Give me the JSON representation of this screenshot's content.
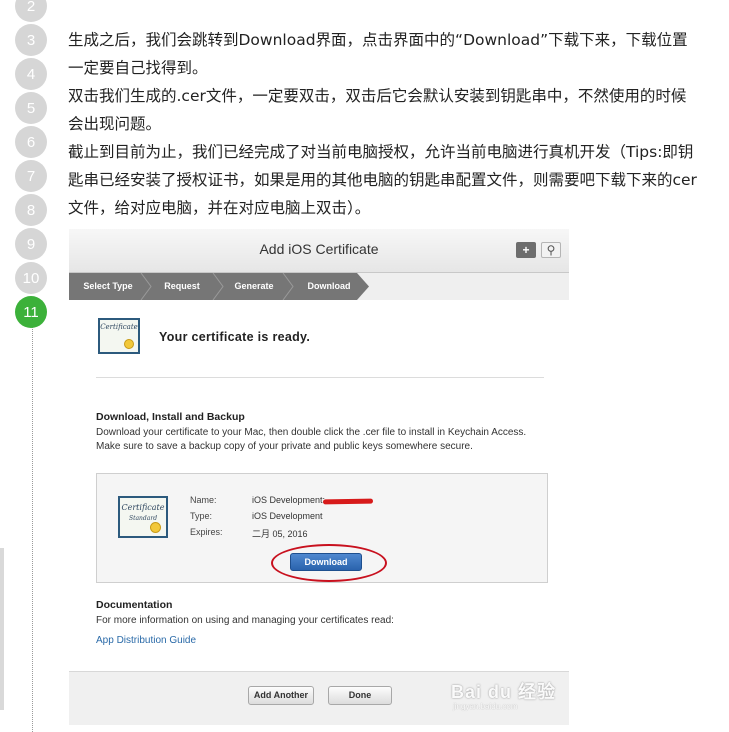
{
  "steps": [
    "2",
    "3",
    "4",
    "5",
    "6",
    "7",
    "8",
    "9",
    "10",
    "11"
  ],
  "article": {
    "p1": "生成之后，我们会跳转到Download界面，点击界面中的“Download”下载下来，下载位置一定要自己找得到。",
    "p2": "双击我们生成的.cer文件，一定要双击，双击后它会默认安装到钥匙串中，不然使用的时候会出现问题。",
    "p3": "截止到目前为止，我们已经完成了对当前电脑授权，允许当前电脑进行真机开发（Tips:即钥匙串已经安装了授权证书，如果是用的其他电脑的钥匙串配置文件，则需要吧下载下来的cer文件，给对应电脑，并在对应电脑上双击）。"
  },
  "screenshot": {
    "title": "Add iOS Certificate",
    "header_icons": [
      "plus-icon",
      "search-icon"
    ],
    "steps": [
      "Select Type",
      "Request",
      "Generate",
      "Download"
    ],
    "active_step": "Download",
    "certificate_icon_text": "Certificate",
    "certificate_icon_sub": "Standard",
    "ready_text": "Your certificate is ready.",
    "dib_title": "Download, Install and Backup",
    "dib_text": "Download your certificate to your Mac, then double click the .cer file to install in Keychain Access. Make sure to save a backup copy of your private and public keys somewhere secure.",
    "cert": {
      "name_label": "Name:",
      "name_value": "iOS Development:",
      "type_label": "Type:",
      "type_value": "iOS Development",
      "expires_label": "Expires:",
      "expires_value": "二月 05, 2016"
    },
    "download_button": "Download",
    "doc_title": "Documentation",
    "doc_text": "For more information on using and managing your certificates read:",
    "doc_link": "App Distribution Guide",
    "add_another_button": "Add Another",
    "done_button": "Done",
    "watermark": "Bai du 经验",
    "watermark_sub": "jingyan.baidu.com"
  },
  "colors": {
    "active_step": "#3cb13a",
    "inactive_step": "#d6d6d6",
    "link": "#2a6aa8",
    "annotation": "#c8101e"
  }
}
